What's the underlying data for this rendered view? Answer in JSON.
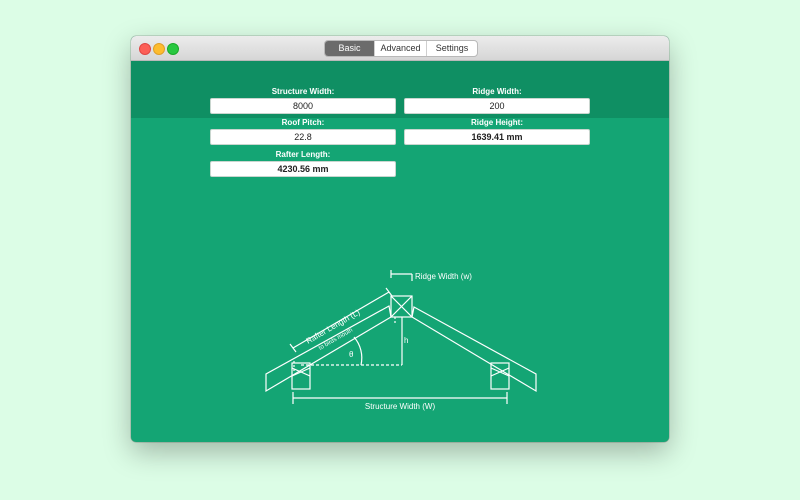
{
  "titlebar": {
    "tabs": [
      "Basic",
      "Advanced",
      "Settings"
    ],
    "active_tab": "Basic"
  },
  "form": {
    "structure_width": {
      "label": "Structure Width:",
      "value": "8000"
    },
    "ridge_width": {
      "label": "Ridge Width:",
      "value": "200"
    },
    "roof_pitch": {
      "label": "Roof Pitch:",
      "value": "22.8"
    },
    "ridge_height": {
      "label": "Ridge Height:",
      "value": "1639.41 mm"
    },
    "rafter_length": {
      "label": "Rafter Length:",
      "value": "4230.56 mm"
    }
  },
  "diagram": {
    "ridge_width_label": "Ridge Width (w)",
    "rafter_length_label": "Rafter Length (L)",
    "rafter_length_sublabel": "to birds mouth",
    "height_label": "h",
    "angle_label": "θ",
    "structure_width_label": "Structure Width (W)"
  },
  "colors": {
    "window_background": "#14a574",
    "header_band": "#0f8f63",
    "desktop": "#dcfde6",
    "active_tab": "#6b6b6b"
  }
}
